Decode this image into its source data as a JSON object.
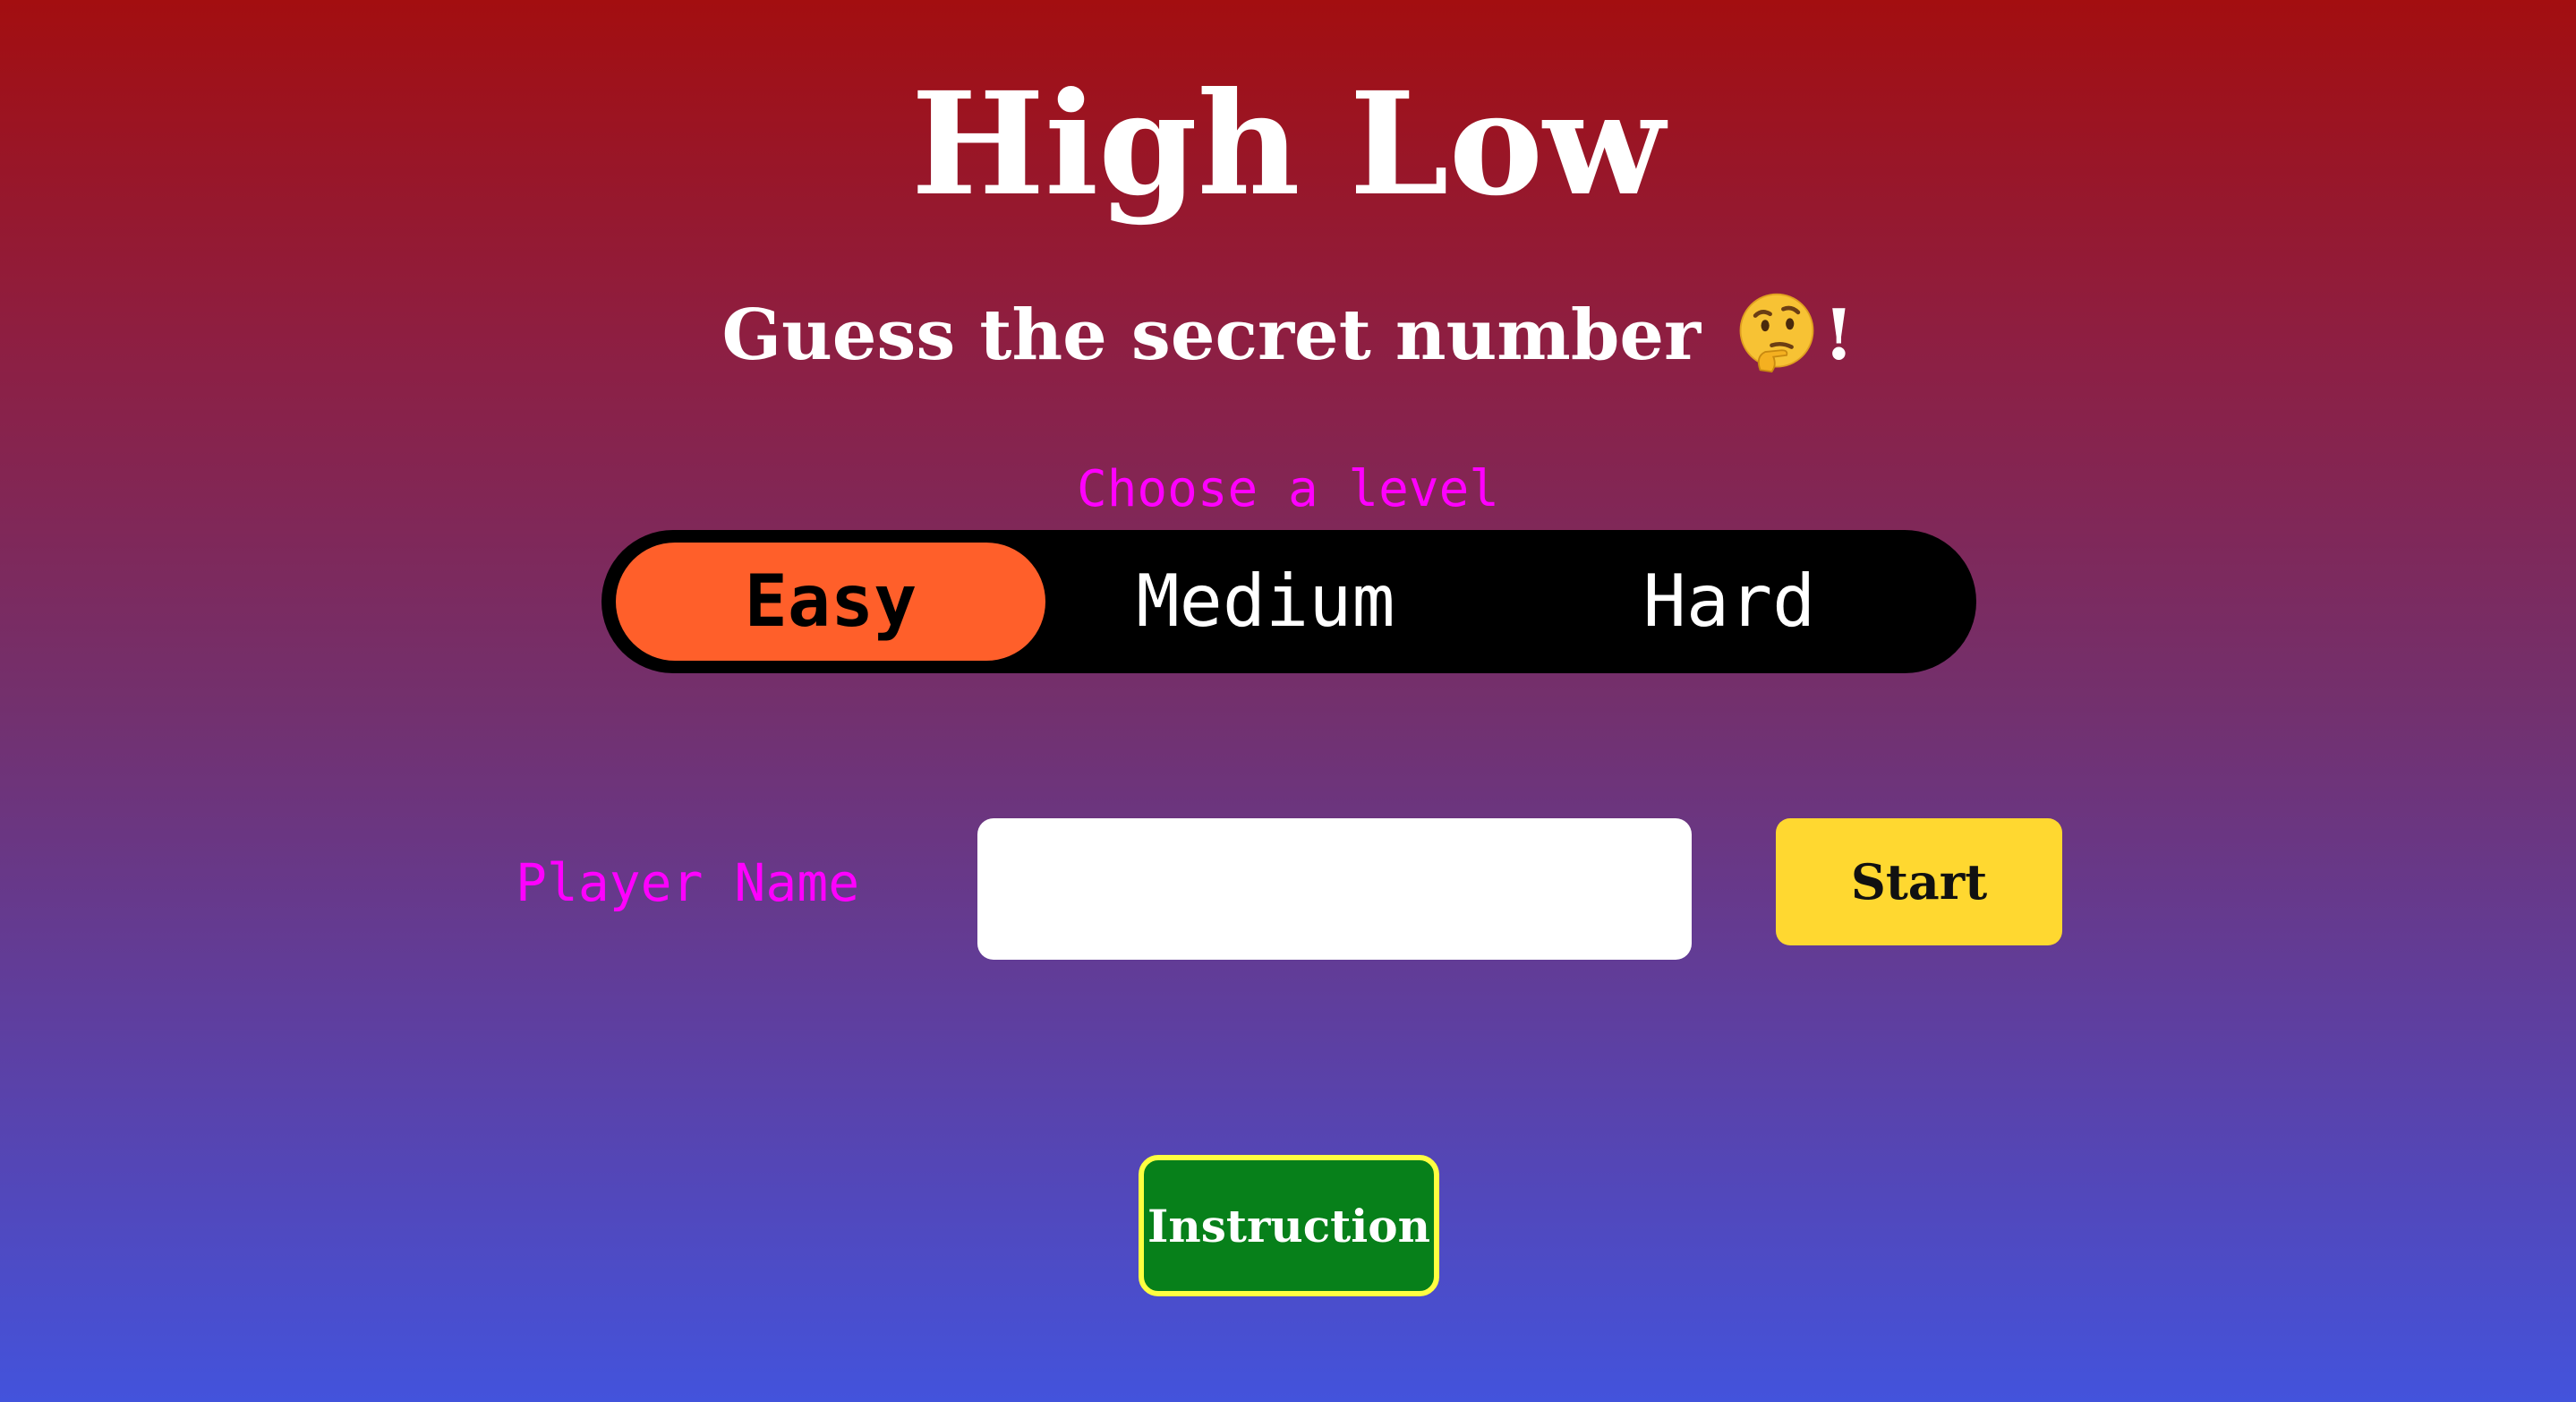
{
  "header": {
    "title": "High Low",
    "subtitle_text": "Guess the secret number ",
    "subtitle_emoji": "thinking-face-icon",
    "subtitle_end": "!"
  },
  "level_picker": {
    "label": "Choose a level",
    "options": [
      {
        "label": "Easy",
        "selected": true
      },
      {
        "label": "Medium",
        "selected": false
      },
      {
        "label": "Hard",
        "selected": false
      }
    ]
  },
  "player": {
    "label": "Player Name",
    "input_value": "",
    "start_label": "Start"
  },
  "instruction": {
    "label": "Instruction"
  },
  "colors": {
    "gradient_top": "#a30e10",
    "gradient_bottom": "#4353dc",
    "accent_magenta": "#ff00ff",
    "selected_level": "#ff5f2a",
    "start_button": "#ffd830",
    "instruction_button": "#07801a",
    "instruction_border": "#ffff40"
  }
}
